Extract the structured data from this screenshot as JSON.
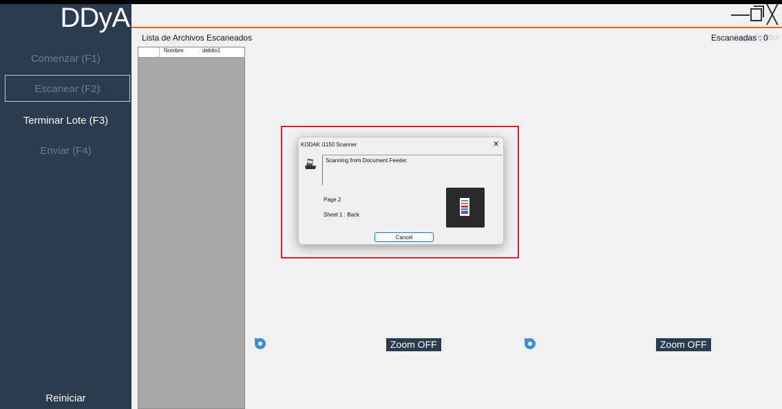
{
  "app": {
    "logo": "DDyA",
    "subtitle": "Digitalizador"
  },
  "sidebar": {
    "items": [
      {
        "label": "Comenzar (F1)"
      },
      {
        "label": "Escanear (F2)"
      },
      {
        "label": "Terminar Lote (F3)"
      },
      {
        "label": "Enviar (F4)"
      }
    ],
    "reset_label": "Reiniciar"
  },
  "main": {
    "list_title": "Lista de Archivos Escaneados",
    "count_label": "Escaneadas : 0",
    "columns": [
      "Nombre",
      "debito1"
    ],
    "zoom_left": "Zoom OFF",
    "zoom_right": "Zoom OFF"
  },
  "dialog": {
    "title": "KODAK i1150 Scanner",
    "status": "Scanning from Document Feeder",
    "page": "Page 2",
    "sheet": "Sheet 1 : Back",
    "cancel_label": "Cancel",
    "close_glyph": "✕"
  },
  "window": {
    "close_glyph": "╳"
  },
  "colors": {
    "sidebar": "#2b3c51",
    "accent": "#e8622c",
    "highlight_frame": "#e01e2a"
  }
}
